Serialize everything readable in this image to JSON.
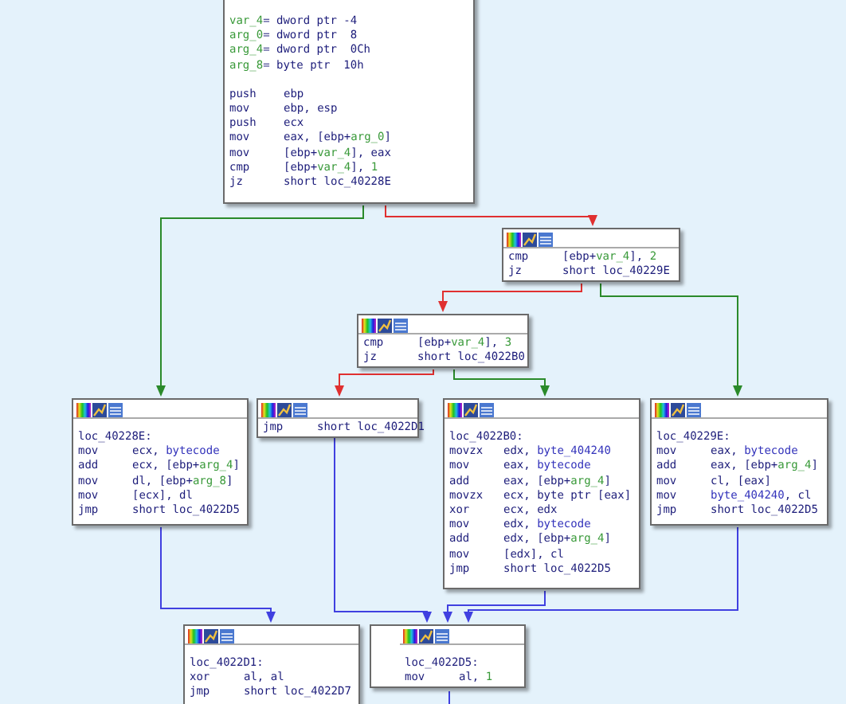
{
  "graph": {
    "nodes": [
      {
        "toolbar": false,
        "lines": [
          {
            "kind": "decl",
            "name": "var_4",
            "def": "= dword ptr -4"
          },
          {
            "kind": "decl",
            "name": "arg_0",
            "def": "= dword ptr  8"
          },
          {
            "kind": "decl",
            "name": "arg_4",
            "def": "= dword ptr  0Ch"
          },
          {
            "kind": "decl",
            "name": "arg_8",
            "def": "= byte ptr  10h"
          },
          {
            "kind": "instr",
            "mnemonic": "push",
            "operands": [
              {
                "text": "ebp"
              }
            ]
          },
          {
            "kind": "instr",
            "mnemonic": "mov",
            "operands": [
              {
                "text": "ebp, esp"
              }
            ]
          },
          {
            "kind": "instr",
            "mnemonic": "push",
            "operands": [
              {
                "text": "ecx"
              }
            ]
          },
          {
            "kind": "instr",
            "mnemonic": "mov",
            "operands": [
              {
                "text": "eax, [ebp+"
              },
              {
                "text": "arg_0",
                "kind": "var"
              },
              {
                "text": "]"
              }
            ]
          },
          {
            "kind": "instr",
            "mnemonic": "mov",
            "operands": [
              {
                "text": "[ebp+"
              },
              {
                "text": "var_4",
                "kind": "var"
              },
              {
                "text": "], eax"
              }
            ]
          },
          {
            "kind": "instr",
            "mnemonic": "cmp",
            "operands": [
              {
                "text": "[ebp+"
              },
              {
                "text": "var_4",
                "kind": "var"
              },
              {
                "text": "], "
              },
              {
                "text": "1",
                "kind": "num"
              }
            ]
          },
          {
            "kind": "instr",
            "mnemonic": "jz",
            "operands": [
              {
                "text": "short loc_40228E"
              }
            ]
          }
        ]
      },
      {
        "toolbar": true,
        "lines": [
          {
            "kind": "instr",
            "mnemonic": "cmp",
            "operands": [
              {
                "text": "[ebp+"
              },
              {
                "text": "var_4",
                "kind": "var"
              },
              {
                "text": "], "
              },
              {
                "text": "2",
                "kind": "num"
              }
            ]
          },
          {
            "kind": "instr",
            "mnemonic": "jz",
            "operands": [
              {
                "text": "short loc_40229E"
              }
            ]
          }
        ]
      },
      {
        "toolbar": true,
        "lines": [
          {
            "kind": "instr",
            "mnemonic": "cmp",
            "operands": [
              {
                "text": "[ebp+"
              },
              {
                "text": "var_4",
                "kind": "var"
              },
              {
                "text": "], "
              },
              {
                "text": "3",
                "kind": "num"
              }
            ]
          },
          {
            "kind": "instr",
            "mnemonic": "jz",
            "operands": [
              {
                "text": "short loc_4022B0"
              }
            ]
          }
        ]
      },
      {
        "toolbar": true,
        "lines": [
          {
            "kind": "label",
            "text": "loc_40228E:"
          },
          {
            "kind": "instr",
            "mnemonic": "mov",
            "operands": [
              {
                "text": "ecx, "
              },
              {
                "text": "bytecode",
                "kind": "name"
              }
            ]
          },
          {
            "kind": "instr",
            "mnemonic": "add",
            "operands": [
              {
                "text": "ecx, [ebp+"
              },
              {
                "text": "arg_4",
                "kind": "var"
              },
              {
                "text": "]"
              }
            ]
          },
          {
            "kind": "instr",
            "mnemonic": "mov",
            "operands": [
              {
                "text": "dl, [ebp+"
              },
              {
                "text": "arg_8",
                "kind": "var"
              },
              {
                "text": "]"
              }
            ]
          },
          {
            "kind": "instr",
            "mnemonic": "mov",
            "operands": [
              {
                "text": "[ecx], dl"
              }
            ]
          },
          {
            "kind": "instr",
            "mnemonic": "jmp",
            "operands": [
              {
                "text": "short loc_4022D5"
              }
            ]
          }
        ]
      },
      {
        "toolbar": true,
        "lines": [
          {
            "kind": "instr",
            "mnemonic": "jmp",
            "operands": [
              {
                "text": "short loc_4022D1"
              }
            ]
          }
        ]
      },
      {
        "toolbar": true,
        "lines": [
          {
            "kind": "label",
            "text": "loc_4022B0:"
          },
          {
            "kind": "instr",
            "mnemonic": "movzx",
            "operands": [
              {
                "text": "edx, "
              },
              {
                "text": "byte_404240",
                "kind": "name"
              }
            ]
          },
          {
            "kind": "instr",
            "mnemonic": "mov",
            "operands": [
              {
                "text": "eax, "
              },
              {
                "text": "bytecode",
                "kind": "name"
              }
            ]
          },
          {
            "kind": "instr",
            "mnemonic": "add",
            "operands": [
              {
                "text": "eax, [ebp+"
              },
              {
                "text": "arg_4",
                "kind": "var"
              },
              {
                "text": "]"
              }
            ]
          },
          {
            "kind": "instr",
            "mnemonic": "movzx",
            "operands": [
              {
                "text": "ecx, byte ptr [eax]"
              }
            ]
          },
          {
            "kind": "instr",
            "mnemonic": "xor",
            "operands": [
              {
                "text": "ecx, edx"
              }
            ]
          },
          {
            "kind": "instr",
            "mnemonic": "mov",
            "operands": [
              {
                "text": "edx, "
              },
              {
                "text": "bytecode",
                "kind": "name"
              }
            ]
          },
          {
            "kind": "instr",
            "mnemonic": "add",
            "operands": [
              {
                "text": "edx, [ebp+"
              },
              {
                "text": "arg_4",
                "kind": "var"
              },
              {
                "text": "]"
              }
            ]
          },
          {
            "kind": "instr",
            "mnemonic": "mov",
            "operands": [
              {
                "text": "[edx], cl"
              }
            ]
          },
          {
            "kind": "instr",
            "mnemonic": "jmp",
            "operands": [
              {
                "text": "short loc_4022D5"
              }
            ]
          }
        ]
      },
      {
        "toolbar": true,
        "lines": [
          {
            "kind": "label",
            "text": "loc_40229E:"
          },
          {
            "kind": "instr",
            "mnemonic": "mov",
            "operands": [
              {
                "text": "eax, "
              },
              {
                "text": "bytecode",
                "kind": "name"
              }
            ]
          },
          {
            "kind": "instr",
            "mnemonic": "add",
            "operands": [
              {
                "text": "eax, [ebp+"
              },
              {
                "text": "arg_4",
                "kind": "var"
              },
              {
                "text": "]"
              }
            ]
          },
          {
            "kind": "instr",
            "mnemonic": "mov",
            "operands": [
              {
                "text": "cl, [eax]"
              }
            ]
          },
          {
            "kind": "instr",
            "mnemonic": "mov",
            "operands": [
              {
                "text": "byte_404240",
                "kind": "name"
              },
              {
                "text": ", cl"
              }
            ]
          },
          {
            "kind": "instr",
            "mnemonic": "jmp",
            "operands": [
              {
                "text": "short loc_4022D5"
              }
            ]
          }
        ]
      },
      {
        "toolbar": true,
        "lines": [
          {
            "kind": "label",
            "text": "loc_4022D1:"
          },
          {
            "kind": "instr",
            "mnemonic": "xor",
            "operands": [
              {
                "text": "al, al"
              }
            ]
          },
          {
            "kind": "instr",
            "mnemonic": "jmp",
            "operands": [
              {
                "text": "short loc_4022D7"
              }
            ]
          }
        ]
      },
      {
        "toolbar": true,
        "lines": [
          {
            "kind": "label",
            "text": "loc_4022D5:"
          },
          {
            "kind": "instr",
            "mnemonic": "mov",
            "operands": [
              {
                "text": "al, "
              },
              {
                "text": "1",
                "kind": "num"
              }
            ]
          }
        ]
      }
    ]
  }
}
